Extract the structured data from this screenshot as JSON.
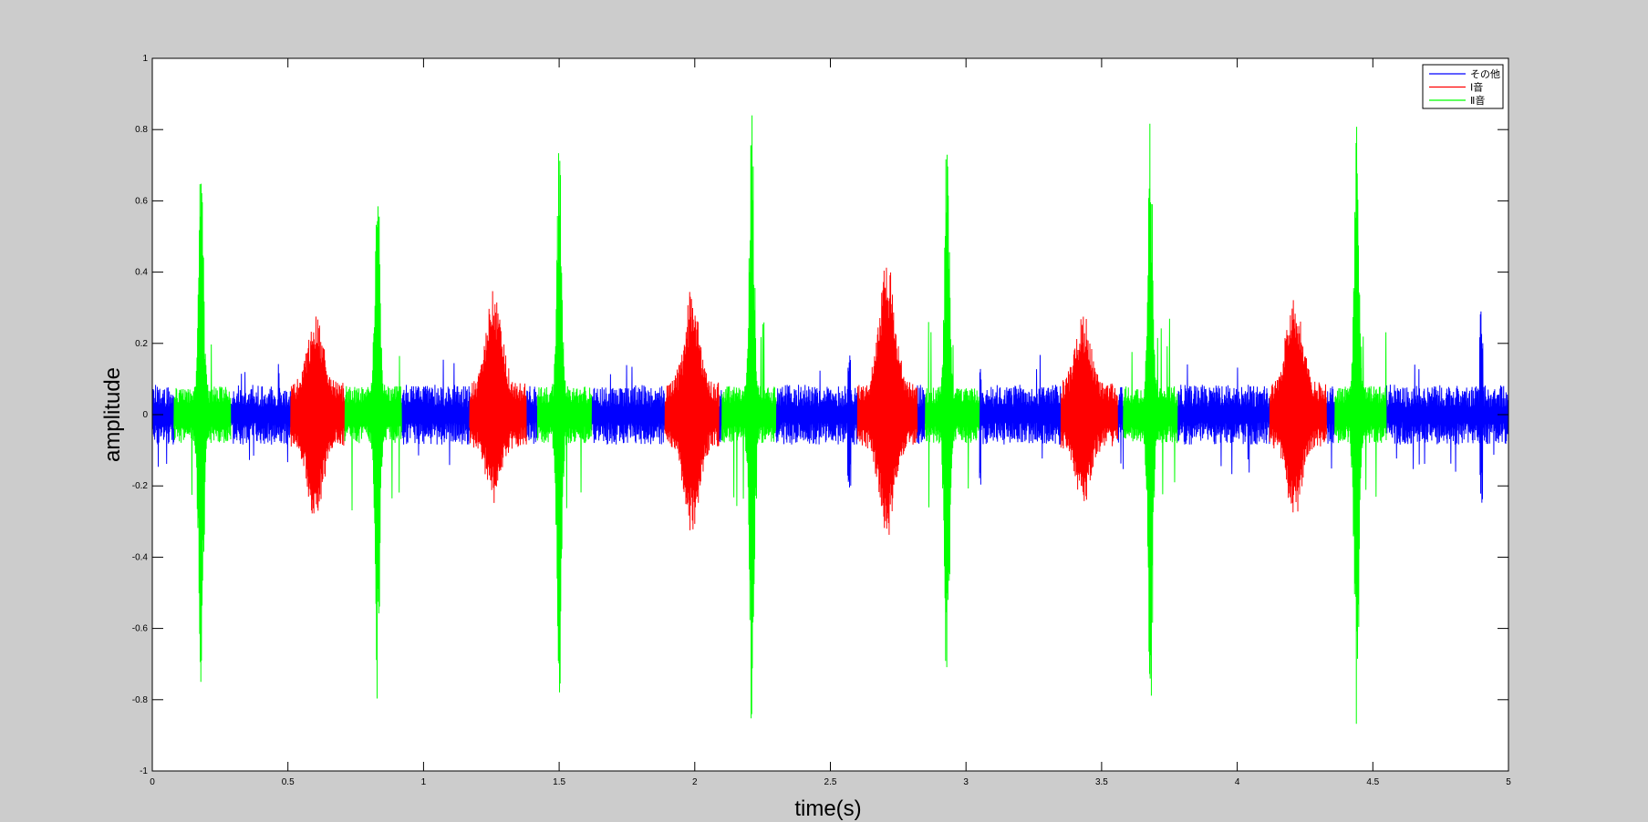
{
  "chart_data": {
    "type": "line",
    "title": "",
    "xlabel": "time(s)",
    "ylabel": "amplitude",
    "xlim": [
      0,
      5
    ],
    "ylim": [
      -1,
      1
    ],
    "xticks": [
      0,
      0.5,
      1,
      1.5,
      2,
      2.5,
      3,
      3.5,
      4,
      4.5,
      5
    ],
    "yticks": [
      -1,
      -0.8,
      -0.6,
      -0.4,
      -0.2,
      0,
      0.2,
      0.4,
      0.6,
      0.8,
      1
    ],
    "xtick_labels": [
      "0",
      "0.5",
      "1",
      "1.5",
      "2",
      "2.5",
      "3",
      "3.5",
      "4",
      "4.5",
      "5"
    ],
    "ytick_labels": [
      "-1",
      "-0.8",
      "-0.6",
      "-0.4",
      "-0.2",
      "0",
      "0.2",
      "0.4",
      "0.6",
      "0.8",
      "1"
    ],
    "grid": false,
    "legend_position": "top-right",
    "series": [
      {
        "name": "その他",
        "color": "#0000ff",
        "segments": [
          [
            0,
            0.08
          ],
          [
            0.29,
            0.51
          ],
          [
            0.92,
            1.17
          ],
          [
            1.38,
            1.42
          ],
          [
            1.62,
            1.89
          ],
          [
            2.09,
            2.1
          ],
          [
            2.3,
            2.6
          ],
          [
            2.82,
            2.85
          ],
          [
            3.05,
            3.35
          ],
          [
            3.56,
            3.58
          ],
          [
            3.78,
            4.12
          ],
          [
            4.33,
            4.36
          ],
          [
            4.55,
            5
          ]
        ],
        "noise_amplitude": 0.07,
        "spikes": [
          {
            "x": 2.57,
            "min": -0.22,
            "max": 0.17
          },
          {
            "x": 3.05,
            "min": -0.2,
            "max": 0.15
          },
          {
            "x": 4.9,
            "min": -0.26,
            "max": 0.29
          }
        ]
      },
      {
        "name": "Ⅰ音",
        "color": "#ff0000",
        "segments": [
          [
            0.51,
            0.71
          ],
          [
            1.17,
            1.38
          ],
          [
            1.89,
            2.09
          ],
          [
            2.6,
            2.82
          ],
          [
            3.35,
            3.56
          ],
          [
            4.12,
            4.33
          ]
        ],
        "peaks": [
          {
            "x": 0.6,
            "min": -0.24,
            "max": 0.22
          },
          {
            "x": 1.26,
            "min": -0.17,
            "max": 0.29
          },
          {
            "x": 1.99,
            "min": -0.27,
            "max": 0.27
          },
          {
            "x": 2.71,
            "min": -0.28,
            "max": 0.38
          },
          {
            "x": 3.43,
            "min": -0.2,
            "max": 0.22
          },
          {
            "x": 4.21,
            "min": -0.21,
            "max": 0.28
          }
        ]
      },
      {
        "name": "Ⅱ音",
        "color": "#00ff00",
        "segments": [
          [
            0.08,
            0.29
          ],
          [
            0.71,
            0.92
          ],
          [
            1.42,
            1.62
          ],
          [
            2.1,
            2.3
          ],
          [
            2.85,
            3.05
          ],
          [
            3.58,
            3.78
          ],
          [
            4.36,
            4.55
          ]
        ],
        "peaks": [
          {
            "x": 0.18,
            "min": -0.78,
            "max": 0.7
          },
          {
            "x": 0.83,
            "min": -0.77,
            "max": 0.7
          },
          {
            "x": 1.5,
            "min": -0.81,
            "max": 0.78
          },
          {
            "x": 2.21,
            "min": -0.88,
            "max": 0.83
          },
          {
            "x": 2.93,
            "min": -0.84,
            "max": 0.8
          },
          {
            "x": 3.68,
            "min": -0.83,
            "max": 0.79
          },
          {
            "x": 4.44,
            "min": -0.9,
            "max": 0.81
          }
        ]
      }
    ]
  }
}
